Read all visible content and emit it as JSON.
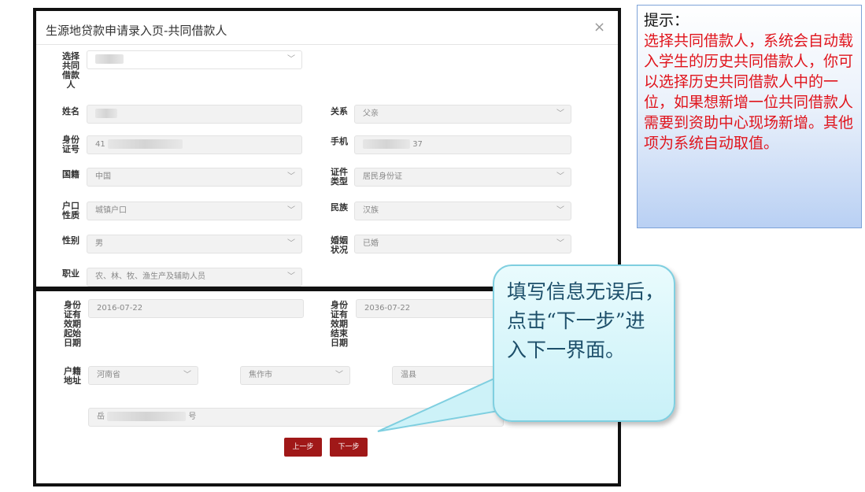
{
  "dialog": {
    "title": "生源地贷款申请录入页-共同借款人",
    "close": "×",
    "labels": {
      "select_co": [
        "选择",
        "共同",
        "借款",
        "人"
      ],
      "name": [
        "姓名"
      ],
      "relation": [
        "关系"
      ],
      "id_no": [
        "身份",
        "证号"
      ],
      "phone": [
        "手机"
      ],
      "nationality": [
        "国籍"
      ],
      "id_type": [
        "证件",
        "类型"
      ],
      "household": [
        "户口",
        "性质"
      ],
      "ethnicity": [
        "民族"
      ],
      "gender": [
        "性别"
      ],
      "marital": [
        "婚姻",
        "状况"
      ],
      "occupation": [
        "职业"
      ],
      "id_start": [
        "身份",
        "证有",
        "效期",
        "起始",
        "日期"
      ],
      "id_end": [
        "身份",
        "证有",
        "效期",
        "结束",
        "日期"
      ],
      "address": [
        "户籍",
        "地址"
      ]
    },
    "values": {
      "relation": "父亲",
      "id_no_prefix": "41",
      "phone_suffix": "37",
      "nationality": "中国",
      "id_type": "居民身份证",
      "household": "城镇户口",
      "ethnicity": "汉族",
      "gender": "男",
      "marital": "已婚",
      "occupation": "农、林、牧、渔生产及辅助人员",
      "id_start": "2016-07-22",
      "id_end": "2036-07-22",
      "province": "河南省",
      "city": "焦作市",
      "county": "温县",
      "street_prefix": "岳",
      "street_suffix": "号"
    },
    "buttons": {
      "prev": "上一步",
      "next": "下一步"
    }
  },
  "tip": {
    "heading": "提示：",
    "body": "选择共同借款人，系统会自动载入学生的历史共同借款人，你可以选择历史共同借款人中的一位，如果想新增一位共同借款人需要到资助中心现场新增。其他项为系统自动取值。"
  },
  "callout": {
    "text": "填写信息无误后，点击“下一步”进入下一界面。"
  }
}
